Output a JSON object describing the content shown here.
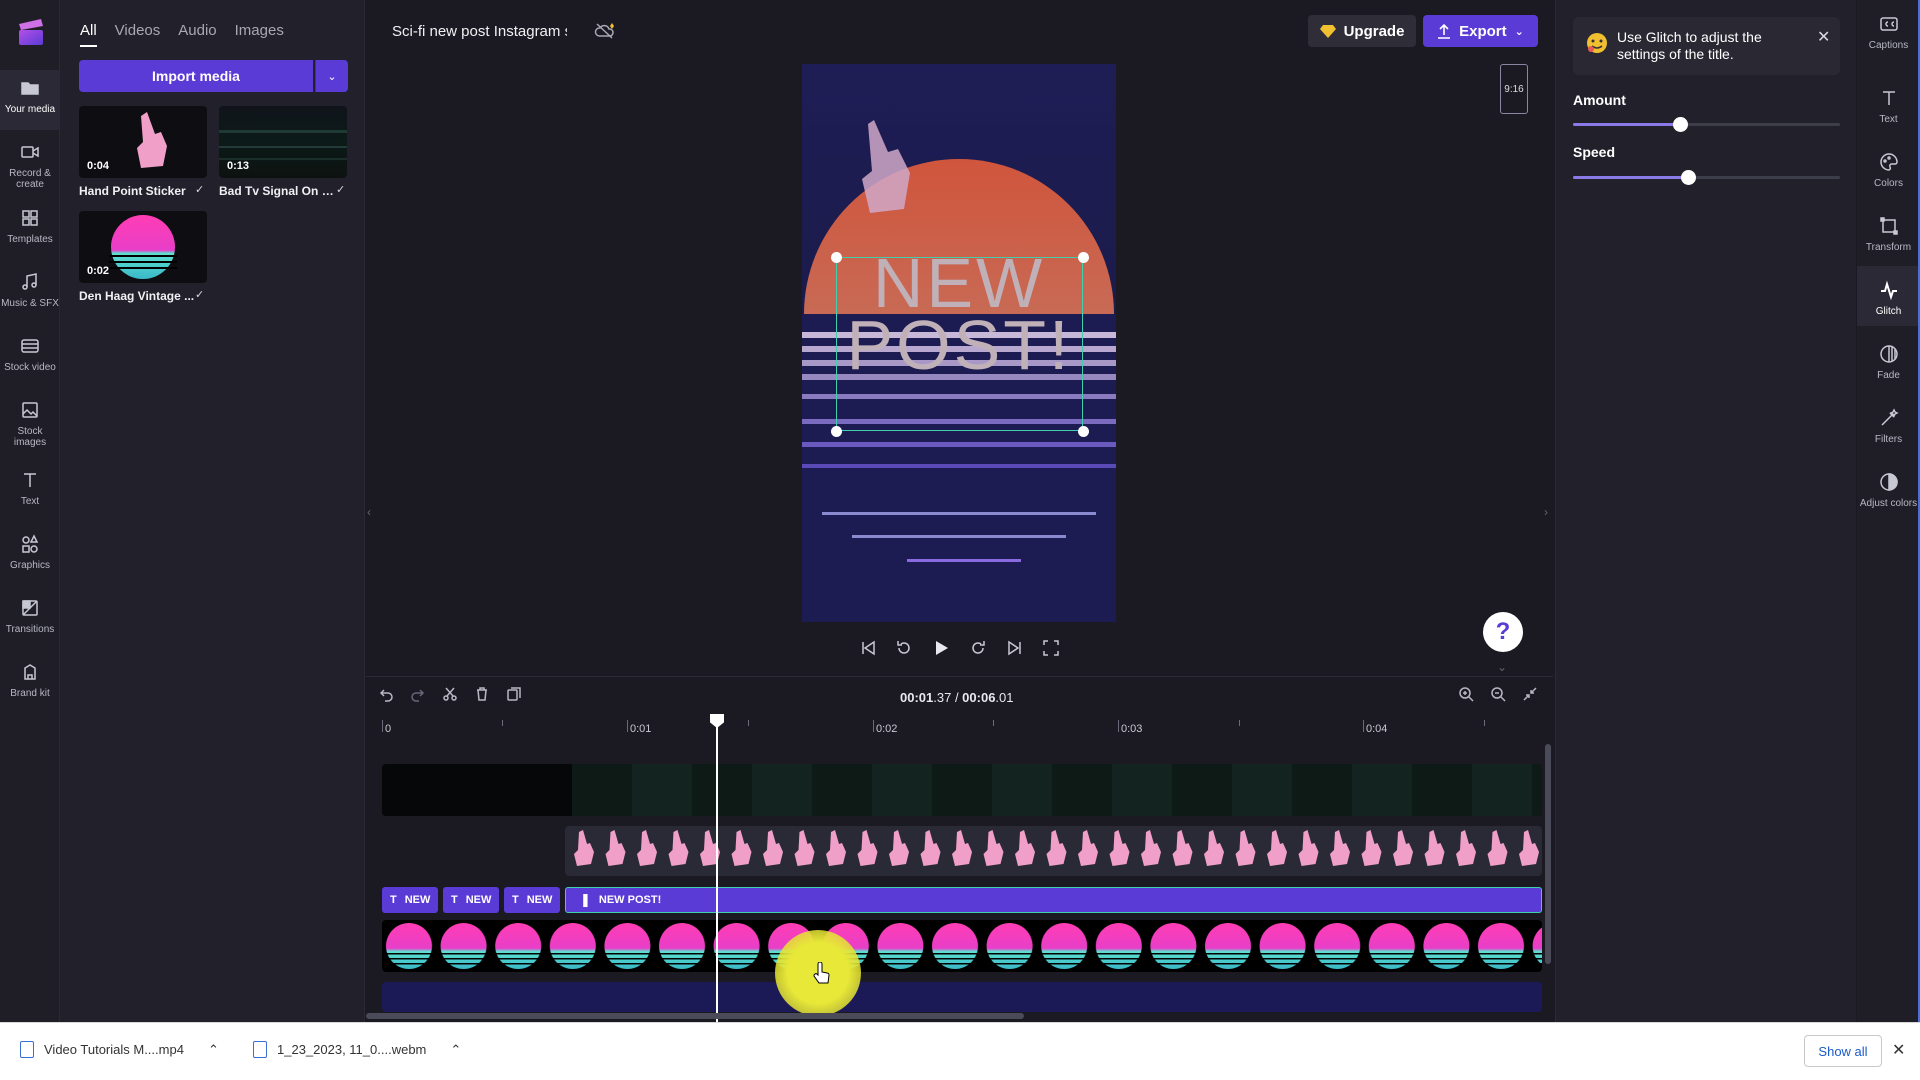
{
  "app": {
    "project_title": "Sci-fi new post Instagram s",
    "upgrade_label": "Upgrade",
    "export_label": "Export",
    "aspect_ratio": "9:16"
  },
  "left_nav": [
    {
      "label": "Your media",
      "icon": "folder-icon"
    },
    {
      "label": "Record & create",
      "icon": "camera-icon"
    },
    {
      "label": "Templates",
      "icon": "templates-icon"
    },
    {
      "label": "Music & SFX",
      "icon": "music-icon"
    },
    {
      "label": "Stock video",
      "icon": "film-icon"
    },
    {
      "label": "Stock images",
      "icon": "image-icon"
    },
    {
      "label": "Text",
      "icon": "text-icon"
    },
    {
      "label": "Graphics",
      "icon": "shapes-icon"
    },
    {
      "label": "Transitions",
      "icon": "transition-icon"
    },
    {
      "label": "Brand kit",
      "icon": "brand-icon"
    }
  ],
  "media": {
    "tabs": [
      "All",
      "Videos",
      "Audio",
      "Images"
    ],
    "import_label": "Import media",
    "items": [
      {
        "name": "Hand Point Sticker",
        "duration": "0:04"
      },
      {
        "name": "Bad Tv Signal On T...",
        "duration": "0:13"
      },
      {
        "name": "Den Haag Vintage ...",
        "duration": "0:02"
      }
    ]
  },
  "preview": {
    "line1": "NEW",
    "line2": "POST!"
  },
  "timeline": {
    "current": "00:01",
    "current_frac": ".37",
    "separator": " / ",
    "total": "00:06",
    "total_frac": ".01",
    "ruler": [
      "0",
      "0:01",
      "0:02",
      "0:03",
      "0:04"
    ],
    "title_chips": [
      "NEW",
      "NEW",
      "NEW"
    ],
    "main_title": "NEW POST!"
  },
  "properties": {
    "tip": "Use Glitch to adjust the settings of the title.",
    "amount_label": "Amount",
    "amount_value": 0.4,
    "speed_label": "Speed",
    "speed_value": 0.43
  },
  "right_nav": [
    {
      "label": "Captions",
      "icon": "captions-icon"
    },
    {
      "label": "Text",
      "icon": "text-icon"
    },
    {
      "label": "Colors",
      "icon": "palette-icon"
    },
    {
      "label": "Transform",
      "icon": "transform-icon"
    },
    {
      "label": "Glitch",
      "icon": "glitch-icon"
    },
    {
      "label": "Fade",
      "icon": "fade-icon"
    },
    {
      "label": "Filters",
      "icon": "filters-icon"
    },
    {
      "label": "Adjust colors",
      "icon": "adjust-icon"
    }
  ],
  "downloads": {
    "items": [
      "Video Tutorials M....mp4",
      "1_23_2023, 11_0....webm"
    ],
    "show_all": "Show all"
  }
}
